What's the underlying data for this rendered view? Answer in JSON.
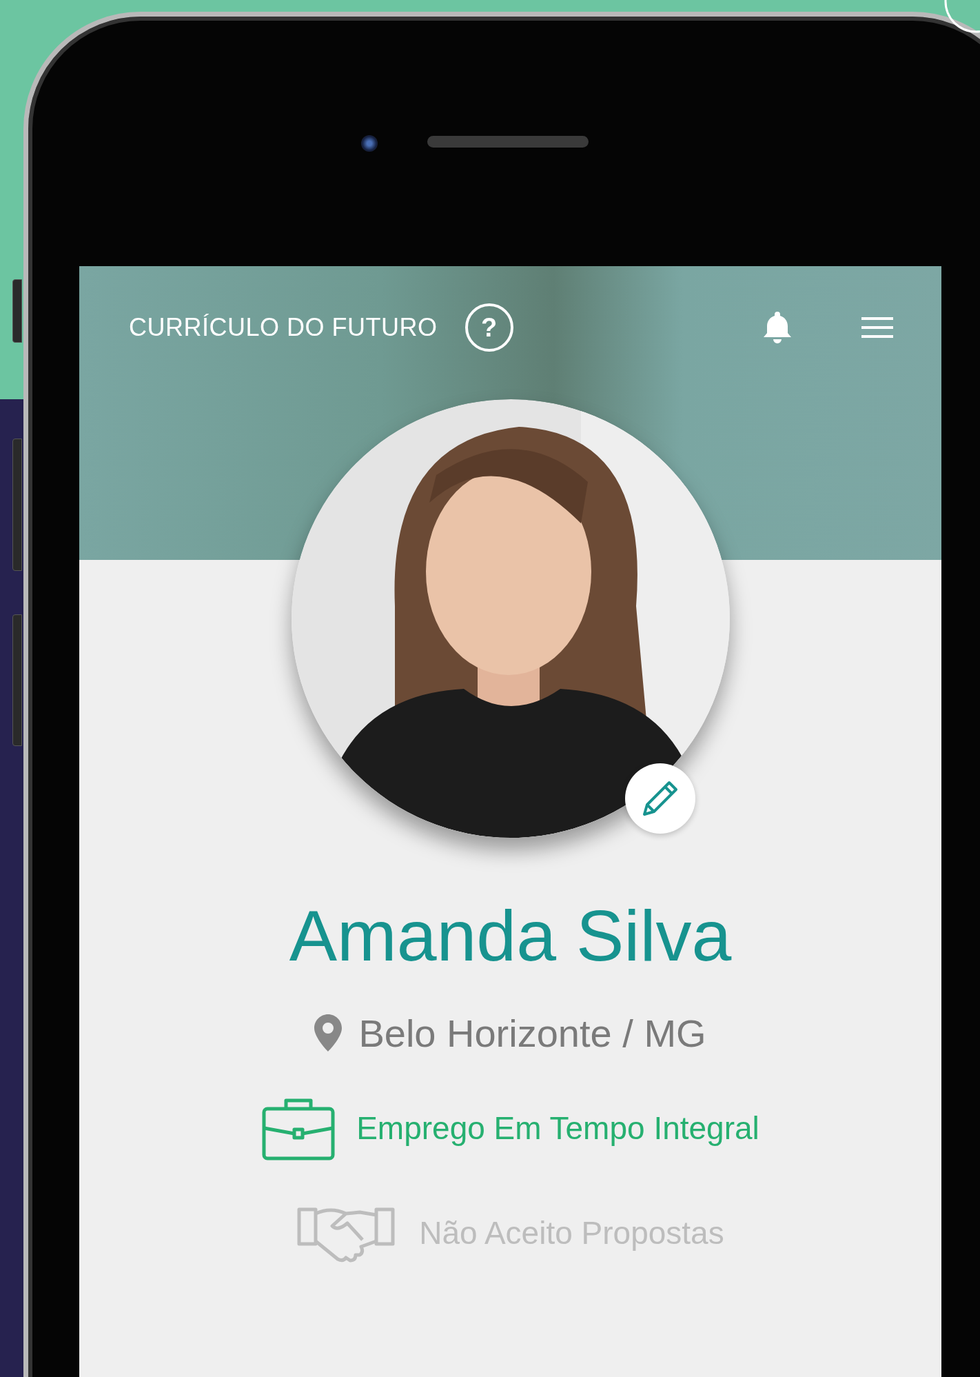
{
  "app_bar": {
    "title": "CURRÍCULO DO FUTURO",
    "help_label": "?"
  },
  "profile": {
    "name": "Amanda Silva",
    "location": "Belo Horizonte / MG"
  },
  "preferences": [
    {
      "kind": "job",
      "label": "Emprego Em Tempo Integral",
      "active": true
    },
    {
      "kind": "proposals",
      "label": "Não Aceito Propostas",
      "active": false
    }
  ]
}
